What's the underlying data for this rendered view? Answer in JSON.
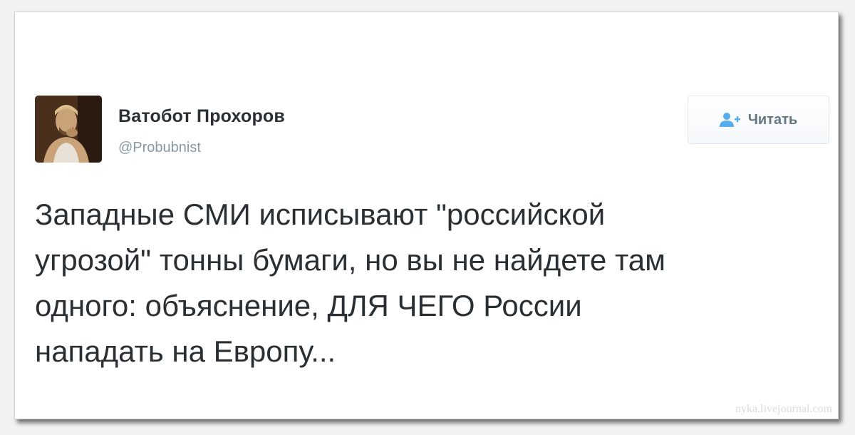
{
  "tweet": {
    "author_name": "Ватобот Прохоров",
    "author_handle": "@Probubnist",
    "avatar_icon": "user-avatar",
    "follow_icon": "add-user-icon",
    "follow_label": "Читать",
    "text_lines": [
      "Западные СМИ исписывают \"российской",
      "угрозой\" тонны бумаги, но вы не найдете там",
      "одного: объяснение, ДЛЯ ЧЕГО России",
      "нападать на Европу..."
    ]
  },
  "watermark": "nyka.livejournal.com",
  "colors": {
    "text": "#292f33",
    "handle": "#8899a6",
    "follow_icon": "#55acee",
    "button_text": "#66757f"
  }
}
